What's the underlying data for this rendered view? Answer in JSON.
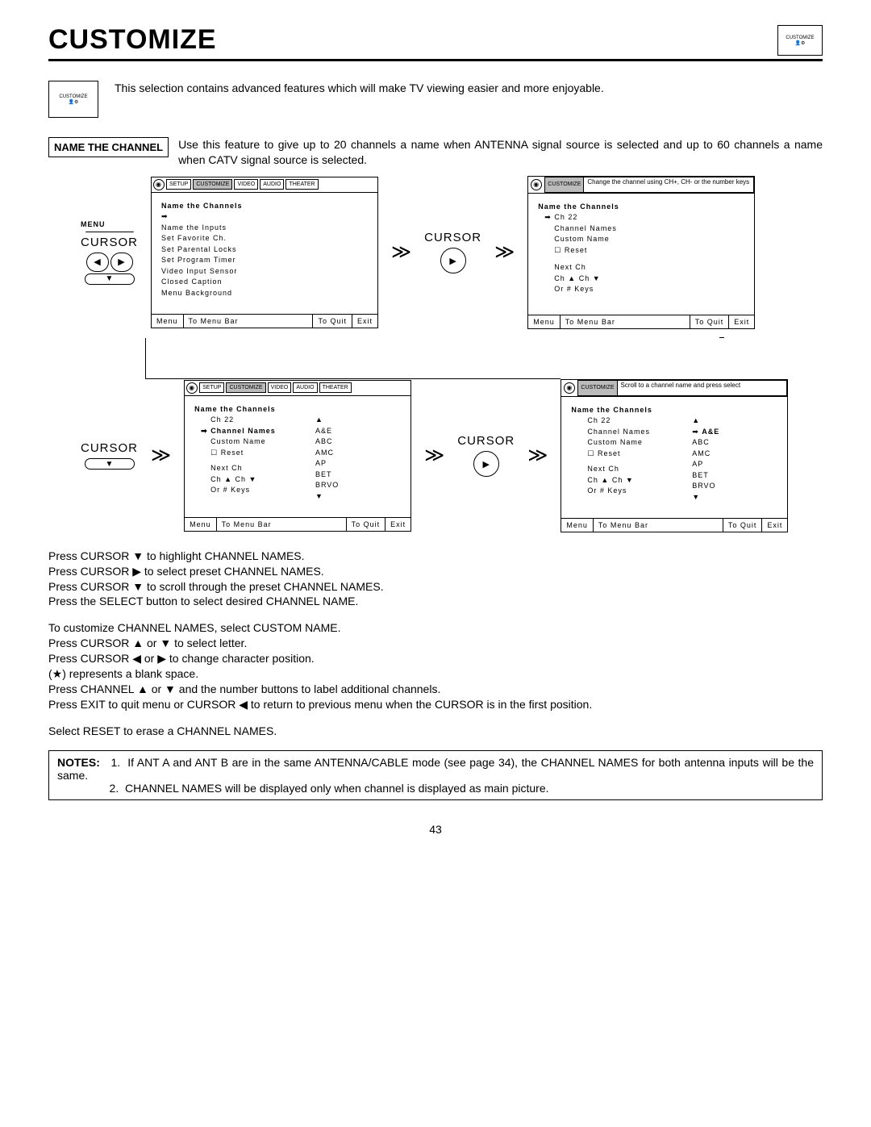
{
  "title": "CUSTOMIZE",
  "logo_text": "CUSTOMIZE",
  "intro": "This selection contains advanced features which will make TV viewing easier and more enjoyable.",
  "section": {
    "label": "NAME THE CHANNEL",
    "text": "Use this feature to give up to 20 channels a name when ANTENNA signal source is selected and up to 60 channels a name when CATV signal source is selected."
  },
  "cursor": "CURSOR",
  "menu": "MENU",
  "tabs": {
    "setup": "SETUP",
    "customize": "CUSTOMIZE",
    "video": "VIDEO",
    "audio": "AUDIO",
    "theater": "THEATER"
  },
  "screen1": {
    "header": "Name the Channels",
    "items": [
      "Name the Inputs",
      "Set Favorite Ch.",
      "Set Parental Locks",
      "Set Program Timer",
      "Video Input Sensor",
      "Closed Caption",
      "Menu Background"
    ]
  },
  "screen2": {
    "info": "Change the channel using CH+, CH- or the number keys",
    "header": "Name the Channels",
    "items_sel": "Ch 22",
    "items": [
      "Channel Names",
      "Custom Name"
    ],
    "reset": "Reset",
    "lines": [
      "Next Ch",
      "Ch ▲ Ch ▼",
      "Or # Keys"
    ]
  },
  "screen3": {
    "header": "Name the Channels",
    "ch": "Ch 22",
    "sel": "Channel Names",
    "custom": "Custom Name",
    "reset": "Reset",
    "lines": [
      "Next Ch",
      "Ch ▲ Ch ▼",
      "Or # Keys"
    ],
    "chanlist": [
      "A&E",
      "ABC",
      "AMC",
      "AP",
      "BET",
      "BRVO"
    ]
  },
  "screen4": {
    "info": "Scroll to a channel name and press select",
    "header": "Name the Channels",
    "ch": "Ch 22",
    "lines1": [
      "Channel Names",
      "Custom Name"
    ],
    "reset": "Reset",
    "lines2": [
      "Next Ch",
      "Ch ▲ Ch ▼",
      "Or # Keys"
    ],
    "chan_sel": "A&E",
    "chanlist": [
      "ABC",
      "AMC",
      "AP",
      "BET",
      "BRVO"
    ]
  },
  "footer": {
    "menu": "Menu",
    "bar": "To Menu Bar",
    "quit": "To Quit",
    "exit": "Exit"
  },
  "instr": {
    "p1": "Press CURSOR ▼ to highlight CHANNEL NAMES.\nPress CURSOR ▶ to select preset CHANNEL NAMES.\nPress CURSOR ▼ to scroll through the preset CHANNEL NAMES.\nPress the SELECT button to select desired CHANNEL NAME.",
    "p2": "To customize CHANNEL NAMES, select CUSTOM NAME.\nPress CURSOR ▲ or ▼ to select letter.\nPress CURSOR ◀ or ▶ to change character position.\n(★) represents a blank space.\nPress CHANNEL ▲ or ▼  and the number buttons to label additional channels.\nPress EXIT to quit menu or CURSOR ◀ to return to previous menu when the CURSOR is in the first position.",
    "p3": "Select RESET to erase a CHANNEL NAMES."
  },
  "notes": {
    "label": "NOTES:",
    "n1": "If ANT A and ANT B are in the same ANTENNA/CABLE mode (see page 34), the CHANNEL NAMES for both antenna                          inputs will be the same.",
    "n2": "CHANNEL NAMES will be displayed only when channel is displayed as main picture."
  },
  "page": "43"
}
